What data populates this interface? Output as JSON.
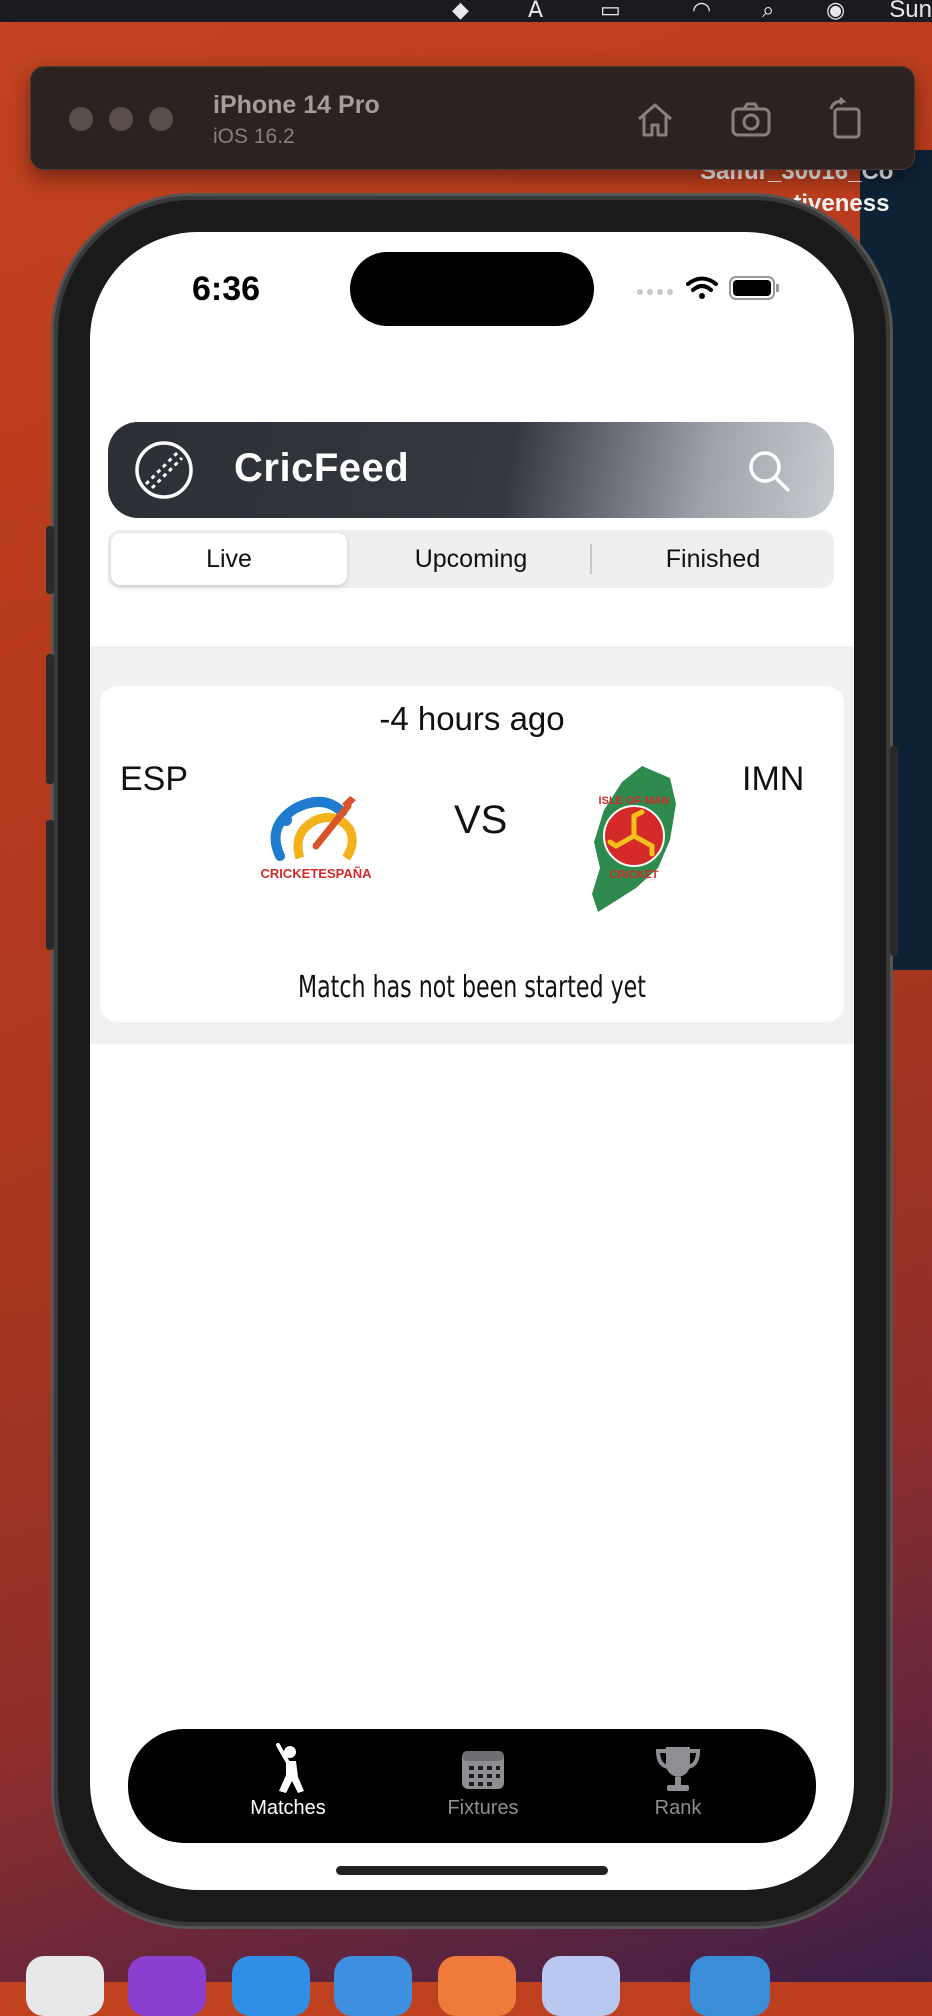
{
  "simulator": {
    "device_name": "iPhone 14 Pro",
    "os_version": "iOS 16.2"
  },
  "background_window": {
    "text_line1": "Saifur_30016_Co",
    "text_line2": "...ctiveness",
    "menubar_clock_partial": "Sun"
  },
  "status_bar": {
    "time": "6:36"
  },
  "app": {
    "title": "CricFeed",
    "segments": [
      "Live",
      "Upcoming",
      "Finished"
    ],
    "selected_segment": "Live"
  },
  "match": {
    "time_ago": "-4 hours ago",
    "team1_code": "ESP",
    "team2_code": "IMN",
    "vs_label": "VS",
    "status": "Match has not been started yet",
    "team1_logo_text": "CRICKETESPAÑA",
    "team2_logo_text_top": "ISLE OF MAN",
    "team2_logo_text_bottom": "CRICKET"
  },
  "tabbar": {
    "items": [
      {
        "label": "Matches",
        "icon": "batsman-icon",
        "active": true
      },
      {
        "label": "Fixtures",
        "icon": "calendar-icon",
        "active": false
      },
      {
        "label": "Rank",
        "icon": "trophy-icon",
        "active": false
      }
    ]
  },
  "colors": {
    "tab_active": "#ffffff",
    "tab_inactive": "#8e8e93",
    "header_dark": "#2c2f36"
  }
}
